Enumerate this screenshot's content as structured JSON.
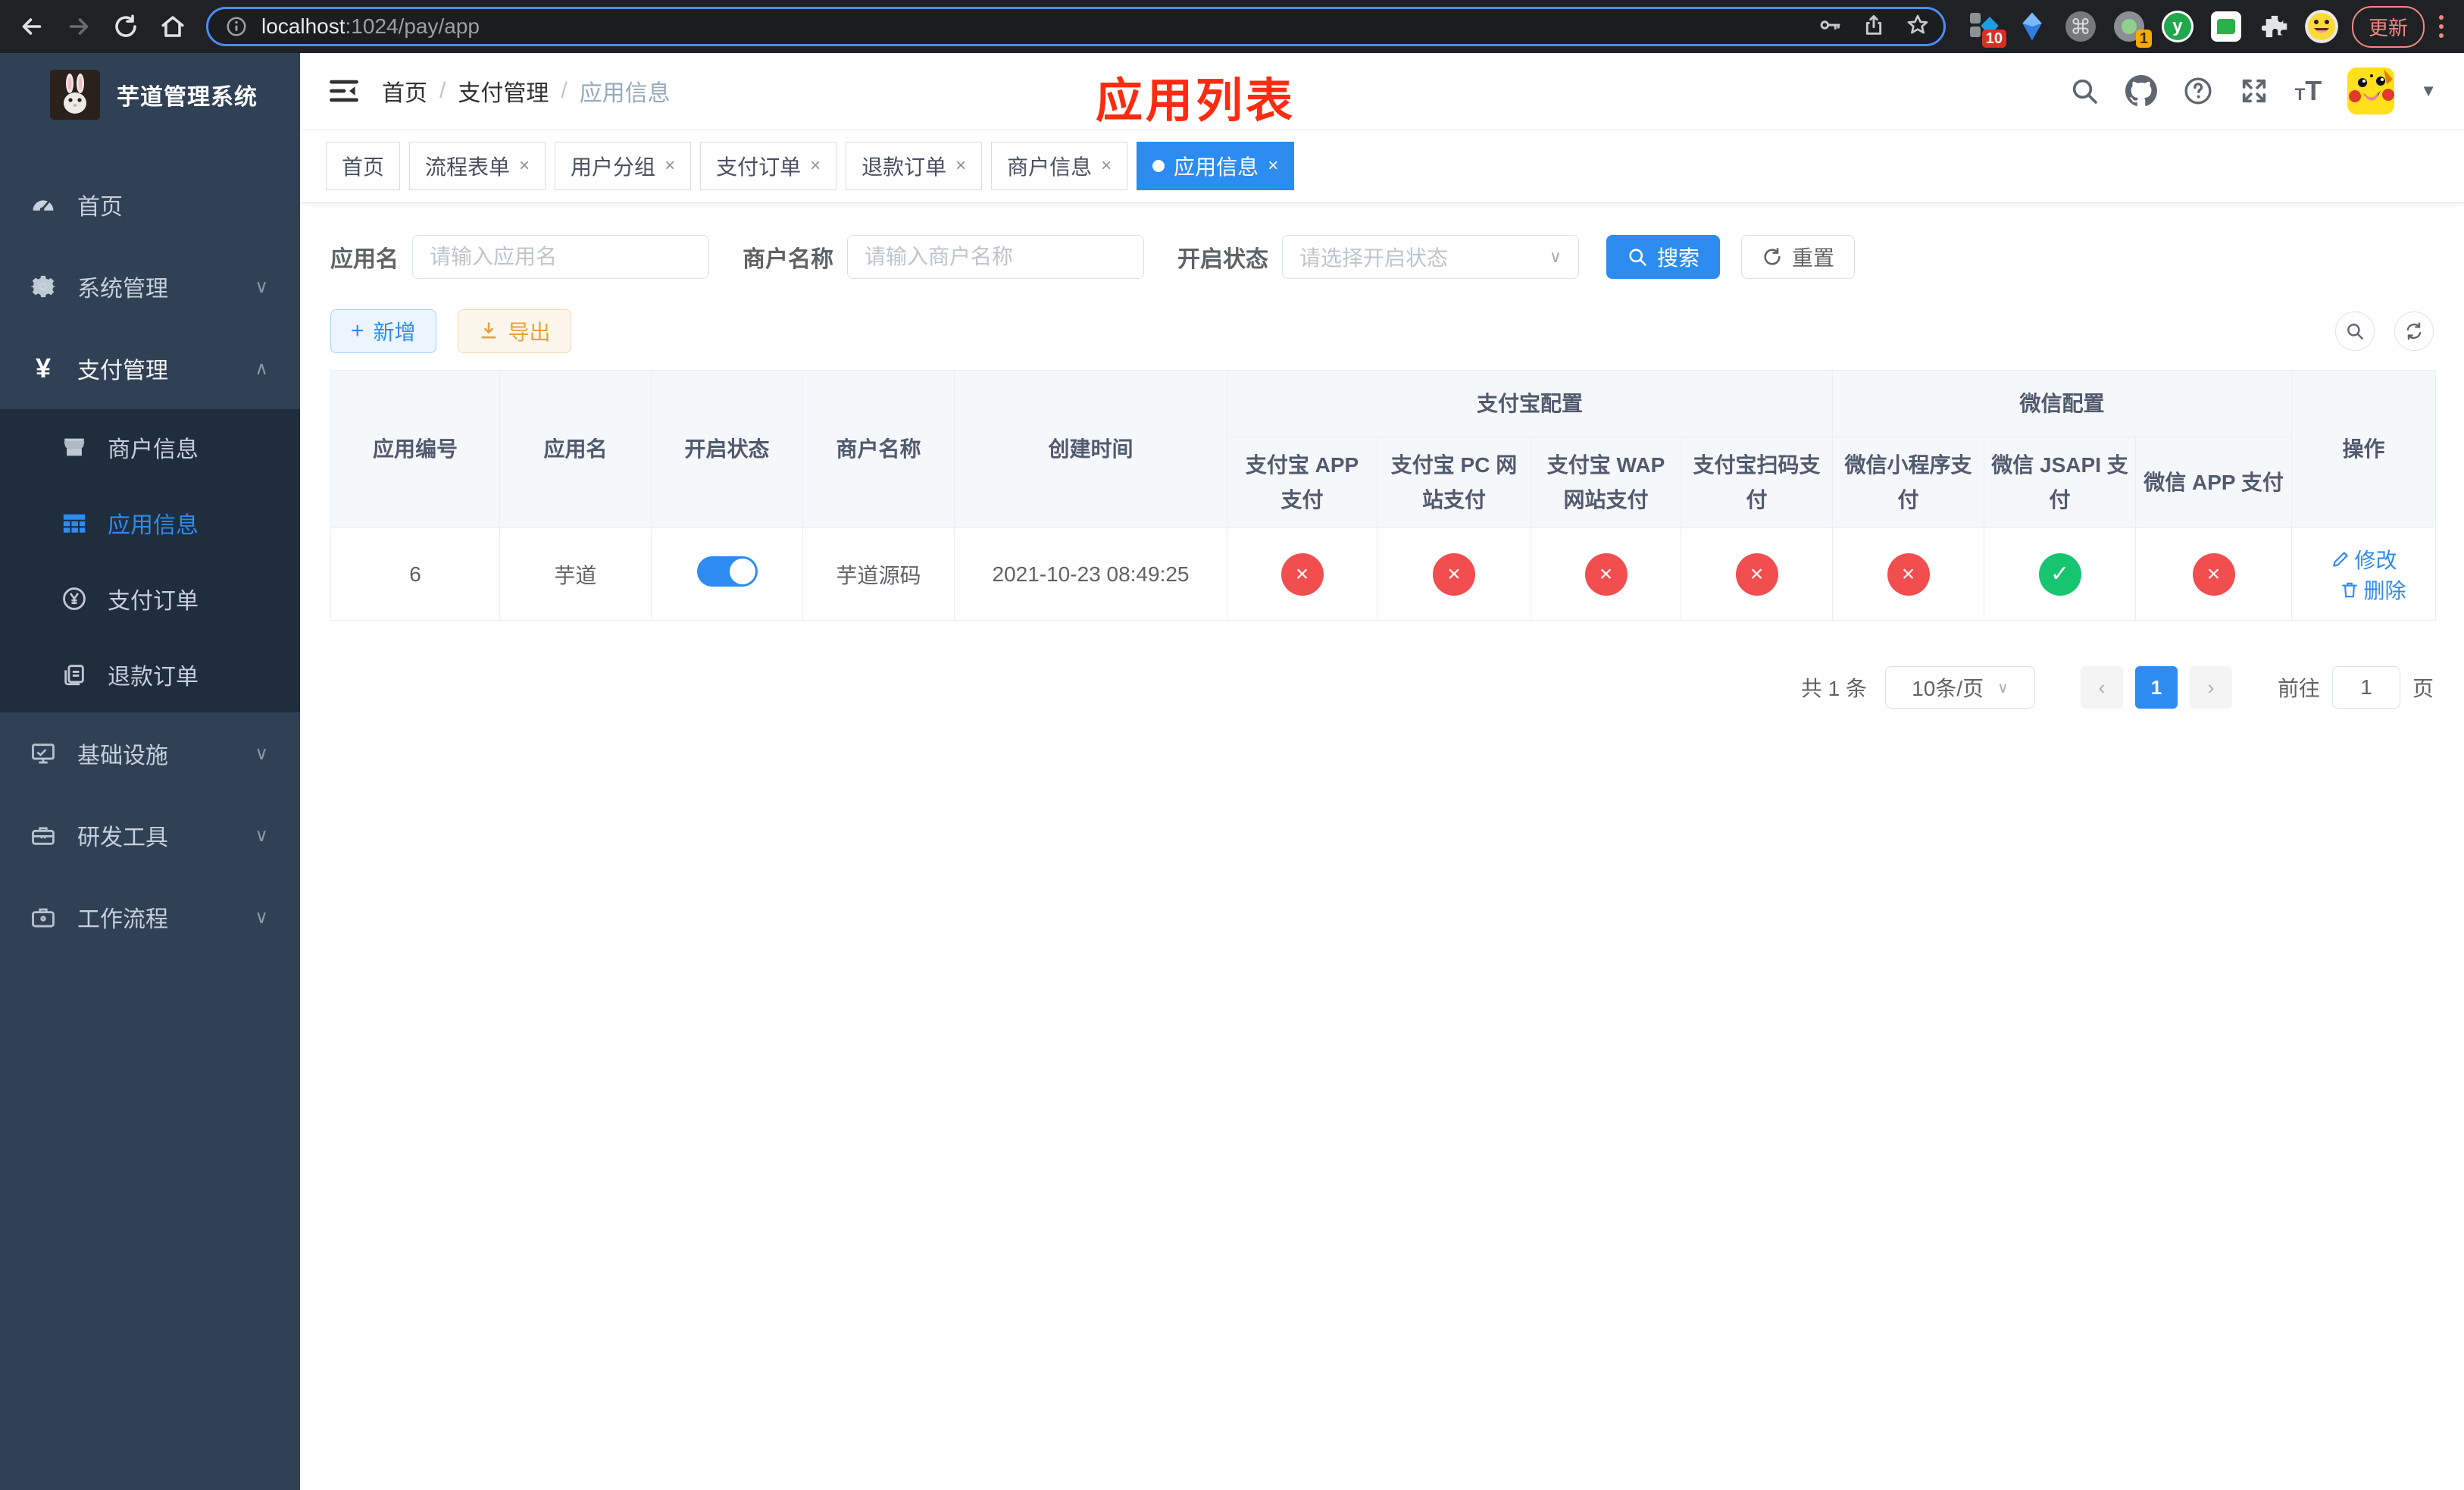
{
  "browser": {
    "url_host": "localhost",
    "url_path": ":1024/pay/app",
    "update_label": "更新",
    "ext_badge_red": "10",
    "ext_badge_orange": "1",
    "ext_y_label": "y"
  },
  "sidebar": {
    "title": "芋道管理系统",
    "items": [
      {
        "label": "首页"
      },
      {
        "label": "系统管理"
      },
      {
        "label": "支付管理"
      },
      {
        "label": "基础设施"
      },
      {
        "label": "研发工具"
      },
      {
        "label": "工作流程"
      }
    ],
    "submenu": [
      {
        "label": "商户信息"
      },
      {
        "label": "应用信息"
      },
      {
        "label": "支付订单"
      },
      {
        "label": "退款订单"
      }
    ]
  },
  "header": {
    "breadcrumb": [
      "首页",
      "支付管理",
      "应用信息"
    ],
    "annotation": "应用列表"
  },
  "tabs": [
    {
      "label": "首页"
    },
    {
      "label": "流程表单"
    },
    {
      "label": "用户分组"
    },
    {
      "label": "支付订单"
    },
    {
      "label": "退款订单"
    },
    {
      "label": "商户信息"
    },
    {
      "label": "应用信息"
    }
  ],
  "filters": {
    "app_name_label": "应用名",
    "app_name_placeholder": "请输入应用名",
    "merchant_label": "商户名称",
    "merchant_placeholder": "请输入商户名称",
    "status_label": "开启状态",
    "status_placeholder": "请选择开启状态",
    "search_label": "搜索",
    "reset_label": "重置"
  },
  "toolbar": {
    "add_label": "新增",
    "export_label": "导出"
  },
  "table": {
    "columns": [
      "应用编号",
      "应用名",
      "开启状态",
      "商户名称",
      "创建时间"
    ],
    "groups": [
      {
        "label": "支付宝配置",
        "children": [
          "支付宝 APP 支付",
          "支付宝 PC 网站支付",
          "支付宝 WAP 网站支付",
          "支付宝扫码支付"
        ]
      },
      {
        "label": "微信配置",
        "children": [
          "微信小程序支付",
          "微信 JSAPI 支付",
          "微信 APP 支付"
        ]
      }
    ],
    "ops_label": "操作",
    "rows": [
      {
        "id": "6",
        "name": "芋道",
        "enabled": true,
        "merchant": "芋道源码",
        "created_at": "2021-10-23 08:49:25",
        "statuses": [
          "fail",
          "fail",
          "fail",
          "fail",
          "fail",
          "pass",
          "fail"
        ],
        "ops": [
          "修改",
          "删除"
        ]
      }
    ]
  },
  "pagination": {
    "total_text": "共 1 条",
    "page_size": "10条/页",
    "prev": "‹",
    "page": "1",
    "next": "›",
    "goto_label": "前往",
    "goto_value": "1",
    "goto_suffix": "页"
  },
  "colors": {
    "accent": "#2d8cf0",
    "danger": "#f24d4f",
    "success": "#17c470",
    "sidebar_bg": "#304156",
    "annotation": "#fd2b11"
  }
}
